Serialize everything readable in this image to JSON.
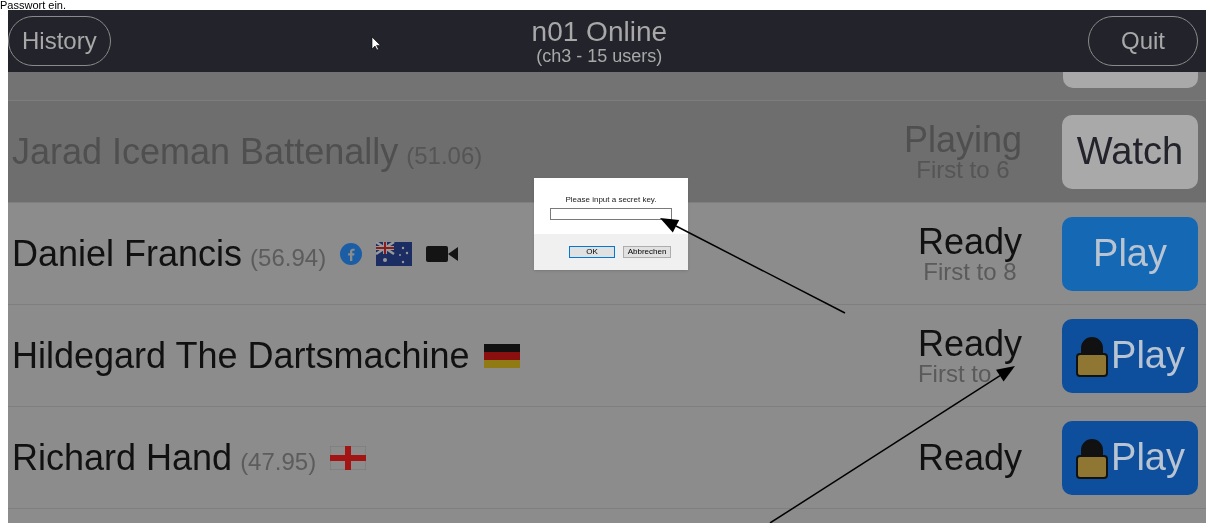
{
  "top_text": "Passwort ein.",
  "header": {
    "left_button": "History",
    "title": "n01 Online",
    "subtitle": "(ch3 - 15 users)",
    "right_button": "Quit"
  },
  "players": [
    {
      "name": "Jarad Iceman Battenally",
      "rating": "(51.06)",
      "playing": true,
      "status": "Playing",
      "first_to": "First to 6",
      "action": "Watch",
      "locked": false
    },
    {
      "name": "Daniel Francis",
      "rating": "(56.94)",
      "playing": false,
      "status": "Ready",
      "first_to": "First to 8",
      "action": "Play",
      "locked": false,
      "badges": [
        {
          "kind": "facebook"
        },
        {
          "kind": "flag_au"
        },
        {
          "kind": "camera"
        }
      ]
    },
    {
      "name": "Hildegard The Dartsmachine",
      "playing": false,
      "status": "Ready",
      "first_to": "First to",
      "action": "Play",
      "locked": true,
      "badges": [
        {
          "kind": "flag_de"
        }
      ]
    },
    {
      "name": "Richard Hand",
      "rating": "(47.95)",
      "playing": false,
      "status": "Ready",
      "action": "Play",
      "locked": true,
      "badges": [
        {
          "kind": "flag_en"
        }
      ]
    }
  ],
  "dialog": {
    "message": "Please input a secret key.",
    "ok": "OK",
    "cancel": "Abbrechen"
  }
}
